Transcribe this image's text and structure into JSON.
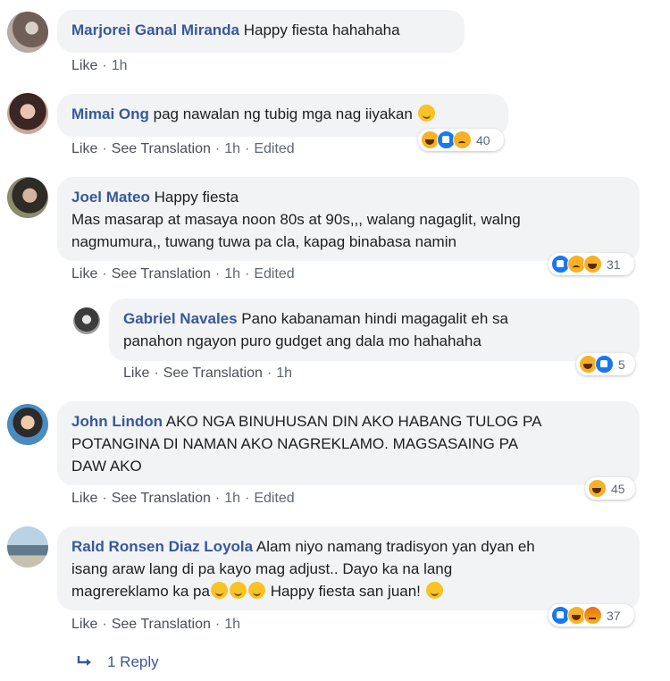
{
  "comments": [
    {
      "author": "Marjorei Ganal Miranda",
      "text": " Happy fiesta hahahaha",
      "actions": {
        "like": "Like",
        "time": "1h"
      }
    },
    {
      "author": "Mimai Ong",
      "text": " pag nawalan ng tubig mga nag iiyakan ",
      "actions": {
        "like": "Like",
        "translate": "See Translation",
        "time": "1h",
        "edited": "Edited"
      },
      "reactions": {
        "count": "40",
        "icons": [
          "haha-icon",
          "like-icon",
          "sad-icon"
        ]
      }
    },
    {
      "author": "Joel Mateo",
      "text_line1": " Happy fiesta",
      "text_line2": "Mas masarap at masaya noon 80s at 90s,,, walang nagaglit, walng",
      "text_line3": "nagmumura,, tuwang tuwa pa cla, kapag binabasa namin",
      "actions": {
        "like": "Like",
        "translate": "See Translation",
        "time": "1h",
        "edited": "Edited"
      },
      "reactions": {
        "count": "31",
        "icons": [
          "like-icon",
          "sad-icon",
          "haha-icon"
        ]
      }
    },
    {
      "author": "Gabriel Navales",
      "text_line1": " Pano kabanaman hindi magagalit eh sa",
      "text_line2": "panahon ngayon puro gudget ang dala mo hahahaha",
      "actions": {
        "like": "Like",
        "translate": "See Translation",
        "time": "1h"
      },
      "reactions": {
        "count": "5",
        "icons": [
          "haha-icon",
          "like-icon"
        ]
      }
    },
    {
      "author": "John Lindon",
      "text_line1": " AKO NGA BINUHUSAN DIN AKO HABANG TULOG PA",
      "text_line2": "POTANGINA DI NAMAN AKO NAGREKLAMO. MAGSASAING PA",
      "text_line3": "DAW AKO",
      "actions": {
        "like": "Like",
        "translate": "See Translation",
        "time": "1h",
        "edited": "Edited"
      },
      "reactions": {
        "count": "45",
        "icons": [
          "haha-icon"
        ]
      }
    },
    {
      "author": "Rald Ronsen Diaz Loyola",
      "text_line1": " Alam niyo namang tradisyon yan dyan eh",
      "text_line2": "isang araw lang di pa kayo mag adjust.. Dayo ka na lang",
      "text_line3a": "magrereklamo ka pa",
      "text_line3b": " Happy fiesta san juan! ",
      "actions": {
        "like": "Like",
        "translate": "See Translation",
        "time": "1h"
      },
      "reactions": {
        "count": "37",
        "icons": [
          "like-icon",
          "haha-icon",
          "angry-icon"
        ]
      }
    }
  ],
  "reply_link": "1 Reply",
  "dot": "·"
}
